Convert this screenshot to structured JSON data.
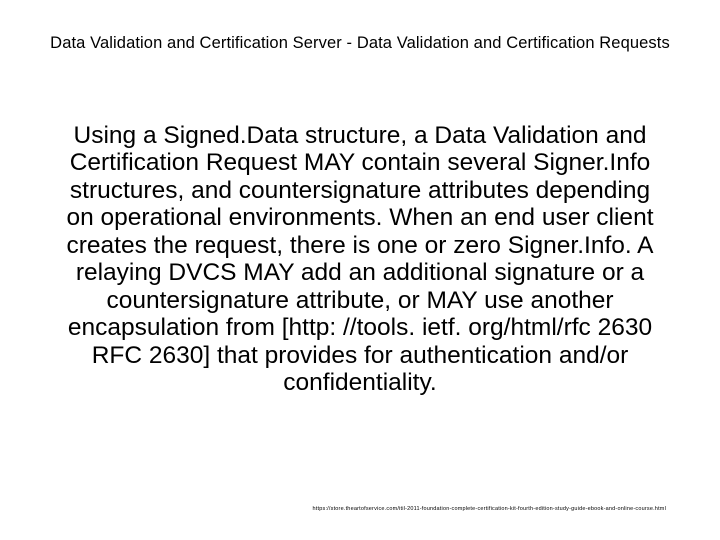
{
  "title": "Data Validation and Certification Server - Data Validation and Certification Requests",
  "body": "Using a Signed.Data structure, a Data Validation and Certification Request MAY contain several Signer.Info structures, and countersignature attributes depending on operational environments. When an end user client creates the request, there is one or zero Signer.Info.  A relaying DVCS MAY add an additional signature or a countersignature attribute, or MAY use another encapsulation from [http: //tools. ietf. org/html/rfc 2630 RFC 2630] that provides for authentication and/or confidentiality.",
  "footer": "https://store.theartofservice.com/itil-2011-foundation-complete-certification-kit-fourth-edition-study-guide-ebook-and-online-course.html"
}
